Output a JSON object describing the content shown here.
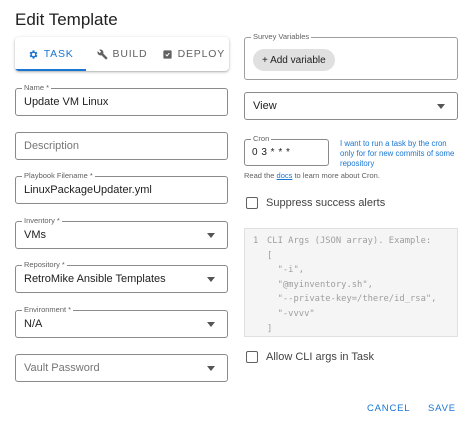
{
  "dialog": {
    "title": "Edit Template"
  },
  "tabs": [
    {
      "label": "TASK",
      "icon": "gear-icon",
      "active": true
    },
    {
      "label": "BUILD",
      "icon": "wrench-icon",
      "active": false
    },
    {
      "label": "DEPLOY",
      "icon": "deploy-icon",
      "active": false
    }
  ],
  "fields": {
    "name": {
      "label": "Name *",
      "value": "Update VM Linux"
    },
    "description": {
      "placeholder": "Description"
    },
    "playbook": {
      "label": "Playbook Filename *",
      "value": "LinuxPackageUpdater.yml"
    },
    "inventory": {
      "label": "Inventory *",
      "value": "VMs"
    },
    "repository": {
      "label": "Repository *",
      "value": "RetroMike Ansible Templates"
    },
    "environment": {
      "label": "Environment *",
      "value": "N/A"
    },
    "vault": {
      "placeholder": "Vault Password"
    }
  },
  "survey": {
    "label": "Survey Variables",
    "add_button": "+ Add variable"
  },
  "view": {
    "value": "View"
  },
  "cron": {
    "label": "Cron",
    "value": "0 3 * * *",
    "hint": "I want to run a task by the cron only for for new commits of some repository",
    "docs_prefix": "Read the ",
    "docs_link": "docs",
    "docs_suffix": " to learn more about Cron."
  },
  "suppress": {
    "label": "Suppress success alerts",
    "checked": false
  },
  "cli_args": {
    "line_number": "1",
    "placeholder": "CLI Args (JSON array). Example:\n[\n  \"-i\",\n  \"@myinventory.sh\",\n  \"--private-key=/there/id_rsa\",\n  \"-vvvv\"\n]"
  },
  "allow_cli": {
    "label": "Allow CLI args in Task",
    "checked": false
  },
  "actions": {
    "cancel": "CANCEL",
    "save": "SAVE"
  },
  "colors": {
    "accent": "#1976d2"
  }
}
